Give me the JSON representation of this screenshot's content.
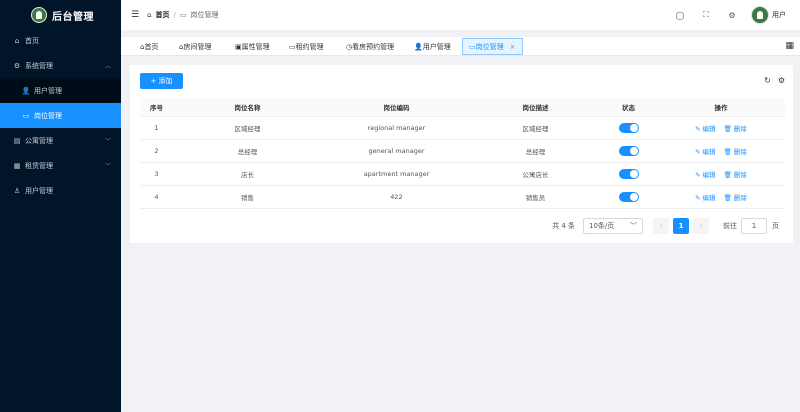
{
  "app": {
    "title": "后台管理"
  },
  "sidebar": {
    "items": [
      {
        "label": "首页",
        "icon": "home-icon"
      },
      {
        "label": "系统管理",
        "icon": "gear-icon",
        "expanded": true,
        "children": [
          {
            "label": "用户管理",
            "icon": "user-icon"
          },
          {
            "label": "岗位管理",
            "icon": "id-card-icon",
            "active": true
          }
        ]
      },
      {
        "label": "公寓管理",
        "icon": "building-icon"
      },
      {
        "label": "租赁管理",
        "icon": "table-icon"
      },
      {
        "label": "用户管理",
        "icon": "person-icon"
      }
    ]
  },
  "header": {
    "breadcrumb": {
      "home": "首页",
      "current": "岗位管理"
    },
    "user": "用户"
  },
  "tabs": [
    {
      "label": "首页"
    },
    {
      "label": "房间管理"
    },
    {
      "label": "属性管理"
    },
    {
      "label": "租约管理"
    },
    {
      "label": "看房预约管理"
    },
    {
      "label": "用户管理"
    },
    {
      "label": "岗位管理",
      "active": true
    }
  ],
  "toolbar": {
    "add_label": "添加"
  },
  "table": {
    "columns": [
      "序号",
      "岗位名称",
      "岗位编码",
      "岗位描述",
      "状态",
      "操作"
    ],
    "rows": [
      {
        "index": "1",
        "name": "区域经理",
        "code": "regional manager",
        "desc": "区域经理",
        "enabled": true
      },
      {
        "index": "2",
        "name": "总经理",
        "code": "general manager",
        "desc": "总经理",
        "enabled": true
      },
      {
        "index": "3",
        "name": "店长",
        "code": "apartment manager",
        "desc": "公寓店长",
        "enabled": true
      },
      {
        "index": "4",
        "name": "销售",
        "code": "422",
        "desc": "销售员",
        "enabled": true
      }
    ],
    "edit_label": "编辑",
    "delete_label": "删除"
  },
  "pagination": {
    "total_text": "共 4 条",
    "page_size": "10条/页",
    "current_page": "1",
    "goto_label": "前往",
    "goto_value": "1",
    "page_suffix": "页"
  },
  "colors": {
    "sidebar_bg": "#001529",
    "accent": "#1890ff"
  }
}
